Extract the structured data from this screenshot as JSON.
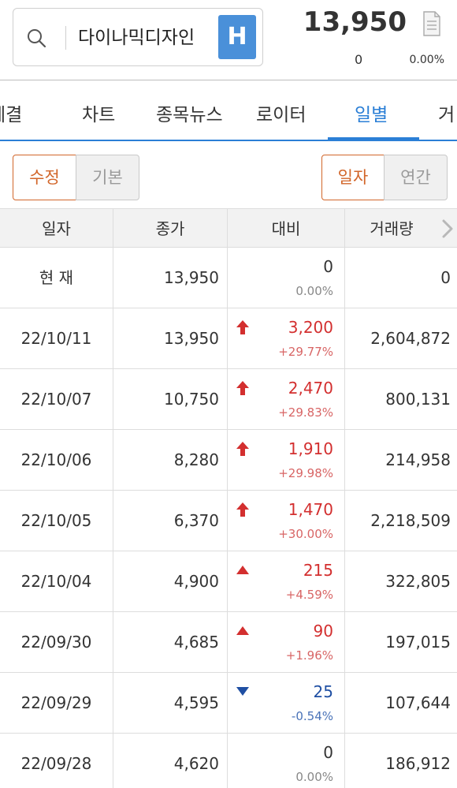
{
  "header": {
    "search_value": "다이나믹디자인",
    "badge": "H",
    "price": "13,950",
    "change": "0",
    "change_pct": "0.00%"
  },
  "tabs": [
    {
      "label": "체결",
      "active": false
    },
    {
      "label": "차트",
      "active": false
    },
    {
      "label": "종목뉴스",
      "active": false
    },
    {
      "label": "로이터",
      "active": false
    },
    {
      "label": "일별",
      "active": true
    },
    {
      "label": "거",
      "active": false
    }
  ],
  "toggles": {
    "left": [
      {
        "label": "수정",
        "selected": true
      },
      {
        "label": "기본",
        "selected": false
      }
    ],
    "right": [
      {
        "label": "일자",
        "selected": true
      },
      {
        "label": "연간",
        "selected": false
      }
    ]
  },
  "table": {
    "headers": [
      "일자",
      "종가",
      "대비",
      "거래량"
    ],
    "rows": [
      {
        "date": "현    재",
        "close": "13,950",
        "diff": "0",
        "pct": "0.00%",
        "dir": "flat",
        "vol": "0"
      },
      {
        "date": "22/10/11",
        "close": "13,950",
        "diff": "3,200",
        "pct": "+29.77%",
        "dir": "limit-up",
        "vol": "2,604,872"
      },
      {
        "date": "22/10/07",
        "close": "10,750",
        "diff": "2,470",
        "pct": "+29.83%",
        "dir": "limit-up",
        "vol": "800,131"
      },
      {
        "date": "22/10/06",
        "close": "8,280",
        "diff": "1,910",
        "pct": "+29.98%",
        "dir": "limit-up",
        "vol": "214,958"
      },
      {
        "date": "22/10/05",
        "close": "6,370",
        "diff": "1,470",
        "pct": "+30.00%",
        "dir": "limit-up",
        "vol": "2,218,509"
      },
      {
        "date": "22/10/04",
        "close": "4,900",
        "diff": "215",
        "pct": "+4.59%",
        "dir": "up",
        "vol": "322,805"
      },
      {
        "date": "22/09/30",
        "close": "4,685",
        "diff": "90",
        "pct": "+1.96%",
        "dir": "up",
        "vol": "197,015"
      },
      {
        "date": "22/09/29",
        "close": "4,595",
        "diff": "25",
        "pct": "-0.54%",
        "dir": "down",
        "vol": "107,644"
      },
      {
        "date": "22/09/28",
        "close": "4,620",
        "diff": "0",
        "pct": "0.00%",
        "dir": "flat",
        "vol": "186,912"
      }
    ]
  },
  "icons": {
    "search": "search-icon",
    "memo": "memo-icon",
    "more": "chevron-right-icon",
    "limit_up": "limit-up-arrow-icon",
    "up": "up-triangle-icon",
    "down": "down-triangle-icon"
  },
  "colors": {
    "accent_blue": "#2b7fd6",
    "select_orange": "#d2662a",
    "up_red": "#d32f2f",
    "down_blue": "#1f4fa3",
    "badge_blue": "#4a90d9"
  }
}
